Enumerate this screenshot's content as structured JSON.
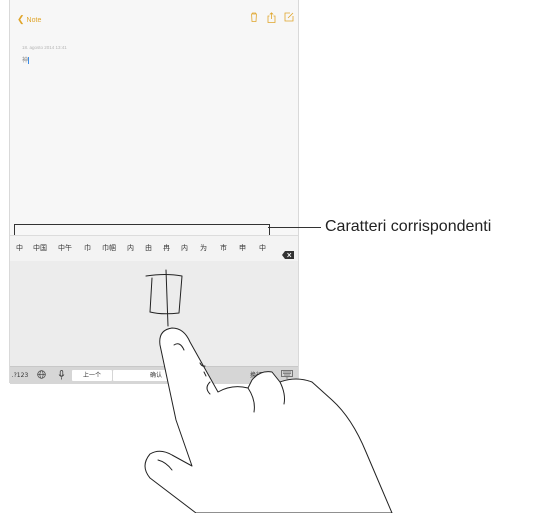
{
  "navbar": {
    "back_label": "Note"
  },
  "note": {
    "date": "18. agosto 2014 13:41",
    "text": "神"
  },
  "candidates": [
    "中",
    "中国",
    "中午",
    "巾",
    "巾帼",
    "内",
    "由",
    "冉",
    "内",
    "为",
    "市",
    "申",
    "中"
  ],
  "toolbar": {
    "numbers_label": ".?123",
    "prev_label": "上一个",
    "confirm_label": "确认",
    "return_label": "换行"
  },
  "callout": {
    "label": "Caratteri corrispondenti"
  },
  "handwriting": {
    "character": "中"
  }
}
